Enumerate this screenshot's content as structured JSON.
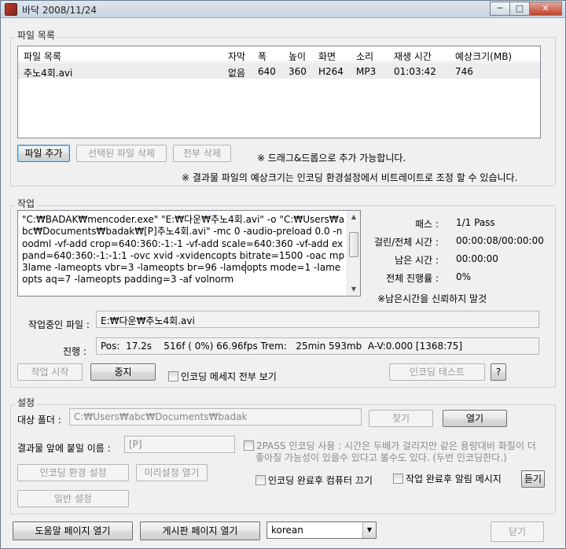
{
  "window": {
    "title": "바닥 2008/11/24",
    "controls": {
      "minimize": "─",
      "maximize": "□",
      "close": "✕"
    }
  },
  "file_list": {
    "section_title": "파일 목록",
    "columns": [
      "파일 목록",
      "자막",
      "폭",
      "높이",
      "화면",
      "소리",
      "재생 시간",
      "예상크기(MB)"
    ],
    "rows": [
      [
        "추노4회.avi",
        "없음",
        "640",
        "360",
        "H264",
        "MP3",
        "01:03:42",
        "746"
      ]
    ],
    "buttons": {
      "add": "파일 추가",
      "remove_selected": "선택된 파일 삭제",
      "remove_all": "전부 삭제"
    },
    "note_drag": "※ 드래그&드롭으로 추가 가능합니다.",
    "note_size": "※ 결과물 파일의 예상크기는 인코딩 환경설정에서 비트레이트로 조정 할 수 있습니다."
  },
  "job": {
    "section_title": "작업",
    "command": "\"C:₩BADAK₩mencoder.exe\" \"E:₩다운₩추노4회.avi\" -o \"C:₩Users₩abc₩Documents₩badak₩[P]추노4회.avi\" -mc 0 -audio-preload 0.0 -noodml -vf-add crop=640:360:-1:-1 -vf-add scale=640:360 -vf-add expand=640:360:-1:-1:1 -ovc xvid -xvidencopts bitrate=1500 -oac mp3lame -lameopts vbr=3 -lameopts br=96 -lameopts mode=1 -lameopts aq=7 -lameopts padding=3 -af volnorm",
    "stats": [
      {
        "label": "패스 :",
        "value": "1/1 Pass"
      },
      {
        "label": "걸린/전체 시간 :",
        "value": "00:00:08/00:00:00"
      },
      {
        "label": "남은 시간 :",
        "value": "00:00:00"
      },
      {
        "label": "전체 진행률 :",
        "value": "0%"
      }
    ],
    "remaining_warning": "※남은시간을 신뢰하지 말것",
    "current_file_label": "작업중인 파일 :",
    "current_file": "E:₩다운₩추노4회.avi",
    "progress_label": "진행 :",
    "progress_text": "Pos:  17.2s    516f ( 0%) 66.96fps Trem:   25min 593mb  A-V:0.000 [1368:75]",
    "buttons": {
      "start": "작업 시작",
      "stop": "중지",
      "encode_test": "인코딩 테스트",
      "help": "?"
    },
    "show_all_messages": "인코딩 메세지 전부 보기"
  },
  "settings": {
    "section_title": "설정",
    "target_folder_label": "대상 폴더 :",
    "target_folder": "C:₩Users₩abc₩Documents₩badak",
    "browse": "찾기",
    "open": "열기",
    "prefix_label": "결과물 앞에 붙일 이름 :",
    "prefix": "[P]",
    "twopass_text_1": "2PASS 인코딩 사용 : 시간은 두배가 걸리지만 같은 용량대비 화질이 더",
    "twopass_text_2": "좋아질 가능성이 있을수 있다고 볼수도 있다. (두번 인코딩한다.)",
    "encode_settings": "인코딩 환경 설정",
    "preset_open": "미리설정 열기",
    "general_settings": "일반 설정",
    "shutdown_after": "인코딩 완료후 컴퓨터 끄기",
    "notify_after": "작업 완료후 알림 메시지",
    "listen": "듣기"
  },
  "footer": {
    "help_page": "도움말 페이지 열기",
    "board_page": "게시판 페이지 열기",
    "language": "korean",
    "close": "닫기"
  }
}
